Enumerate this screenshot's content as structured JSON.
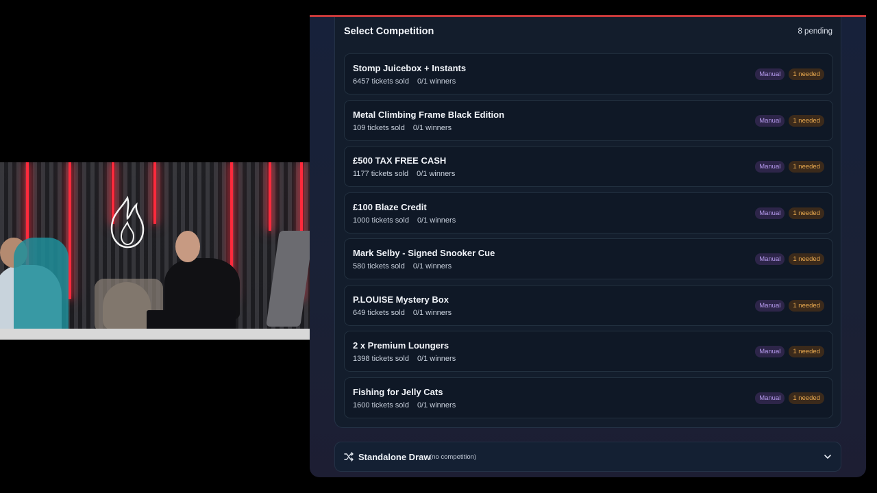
{
  "panel": {
    "title": "Select Competition",
    "pending": "8 pending",
    "competitions": [
      {
        "name": "Stomp Juicebox + Instants",
        "tickets": "6457 tickets sold",
        "winners": "0/1 winners",
        "mode": "Manual",
        "needed": "1 needed"
      },
      {
        "name": "Metal Climbing Frame Black Edition",
        "tickets": "109 tickets sold",
        "winners": "0/1 winners",
        "mode": "Manual",
        "needed": "1 needed"
      },
      {
        "name": "£500 TAX FREE CASH",
        "tickets": "1177 tickets sold",
        "winners": "0/1 winners",
        "mode": "Manual",
        "needed": "1 needed"
      },
      {
        "name": "£100 Blaze Credit",
        "tickets": "1000 tickets sold",
        "winners": "0/1 winners",
        "mode": "Manual",
        "needed": "1 needed"
      },
      {
        "name": "Mark Selby - Signed Snooker Cue",
        "tickets": "580 tickets sold",
        "winners": "0/1 winners",
        "mode": "Manual",
        "needed": "1 needed"
      },
      {
        "name": "P.LOUISE Mystery Box",
        "tickets": "649 tickets sold",
        "winners": "0/1 winners",
        "mode": "Manual",
        "needed": "1 needed"
      },
      {
        "name": "2 x Premium Loungers",
        "tickets": "1398 tickets sold",
        "winners": "0/1 winners",
        "mode": "Manual",
        "needed": "1 needed"
      },
      {
        "name": "Fishing for Jelly Cats",
        "tickets": "1600 tickets sold",
        "winners": "0/1 winners",
        "mode": "Manual",
        "needed": "1 needed"
      }
    ],
    "standalone": {
      "title": "Standalone Draw",
      "subtitle": "(no competition)",
      "icon": "shuffle-icon",
      "chevron": "chevron-down-icon"
    }
  },
  "colors": {
    "accent_top_border": "#c7393a",
    "manual_badge": "#b79bef",
    "needed_badge": "#e9a94f",
    "neon": "#ff2a3c"
  }
}
